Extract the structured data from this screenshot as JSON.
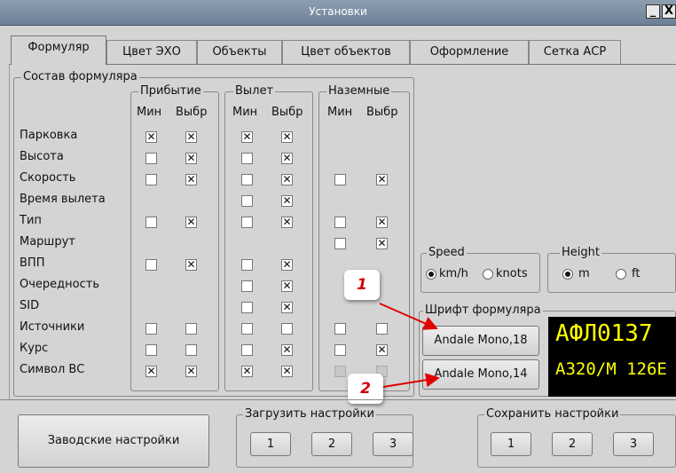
{
  "window": {
    "title": "Установки",
    "minimize_glyph": "_",
    "close_glyph": "X"
  },
  "tabs": [
    {
      "label": "Формуляр",
      "active": true
    },
    {
      "label": "Цвет ЭХО",
      "active": false
    },
    {
      "label": "Объекты",
      "active": false
    },
    {
      "label": "Цвет объектов",
      "active": false
    },
    {
      "label": "Оформление",
      "active": false
    },
    {
      "label": "Сетка АСР",
      "active": false
    }
  ],
  "composition": {
    "title": "Состав формуляра",
    "groups": {
      "arrival": "Прибытие",
      "departure": "Вылет",
      "ground": "Наземные"
    },
    "col_min": "Мин",
    "col_sel": "Выбр",
    "rows": [
      {
        "label": "Парковка",
        "arr": [
          "x",
          "x"
        ],
        "dep": [
          "x",
          "x"
        ],
        "gnd": [
          "",
          ""
        ]
      },
      {
        "label": "Высота",
        "arr": [
          "o",
          "x"
        ],
        "dep": [
          "o",
          "x"
        ],
        "gnd": [
          "",
          ""
        ]
      },
      {
        "label": "Скорость",
        "arr": [
          "o",
          "x"
        ],
        "dep": [
          "o",
          "x"
        ],
        "gnd": [
          "o",
          "x"
        ]
      },
      {
        "label": "Время вылета",
        "arr": [
          "",
          ""
        ],
        "dep": [
          "o",
          "x"
        ],
        "gnd": [
          "",
          ""
        ]
      },
      {
        "label": "Тип",
        "arr": [
          "o",
          "x"
        ],
        "dep": [
          "o",
          "x"
        ],
        "gnd": [
          "o",
          "x"
        ]
      },
      {
        "label": "Маршрут",
        "arr": [
          "",
          ""
        ],
        "dep": [
          "",
          ""
        ],
        "gnd": [
          "o",
          "x"
        ]
      },
      {
        "label": "ВПП",
        "arr": [
          "o",
          "x"
        ],
        "dep": [
          "o",
          "x"
        ],
        "gnd": [
          "",
          ""
        ]
      },
      {
        "label": "Очередность",
        "arr": [
          "",
          ""
        ],
        "dep": [
          "o",
          "x"
        ],
        "gnd": [
          "",
          ""
        ]
      },
      {
        "label": "SID",
        "arr": [
          "",
          ""
        ],
        "dep": [
          "o",
          "x"
        ],
        "gnd": [
          "",
          ""
        ]
      },
      {
        "label": "Источники",
        "arr": [
          "o",
          "o"
        ],
        "dep": [
          "o",
          "o"
        ],
        "gnd": [
          "o",
          "o"
        ]
      },
      {
        "label": "Курс",
        "arr": [
          "o",
          "o"
        ],
        "dep": [
          "o",
          "x"
        ],
        "gnd": [
          "o",
          "x"
        ]
      },
      {
        "label": "Символ ВС",
        "arr": [
          "x",
          "x"
        ],
        "dep": [
          "x",
          "x"
        ],
        "gnd": [
          "d",
          "d"
        ]
      }
    ]
  },
  "speed": {
    "title": "Speed",
    "options": [
      "km/h",
      "knots"
    ],
    "selected": "km/h"
  },
  "height": {
    "title": "Height",
    "options": [
      "m",
      "ft"
    ],
    "selected": "m"
  },
  "font": {
    "title": "Шрифт формуляра",
    "button1": "Andale Mono,18",
    "button2": "Andale Mono,14",
    "preview_line1": "АФЛ0137",
    "preview_line2": "A320/M 126E",
    "preview_color": "#ffff00"
  },
  "callouts": [
    "1",
    "2"
  ],
  "bottom": {
    "factory_button": "Заводские настройки",
    "load": {
      "title": "Загрузить настройки",
      "buttons": [
        "1",
        "2",
        "3"
      ]
    },
    "save": {
      "title": "Сохранить настройки",
      "buttons": [
        "1",
        "2",
        "3"
      ]
    }
  },
  "colors": {
    "titlebar": "#7a8ca2",
    "background": "#d4d4d4",
    "callout_text": "#d00000",
    "arrow": "#e00000"
  }
}
